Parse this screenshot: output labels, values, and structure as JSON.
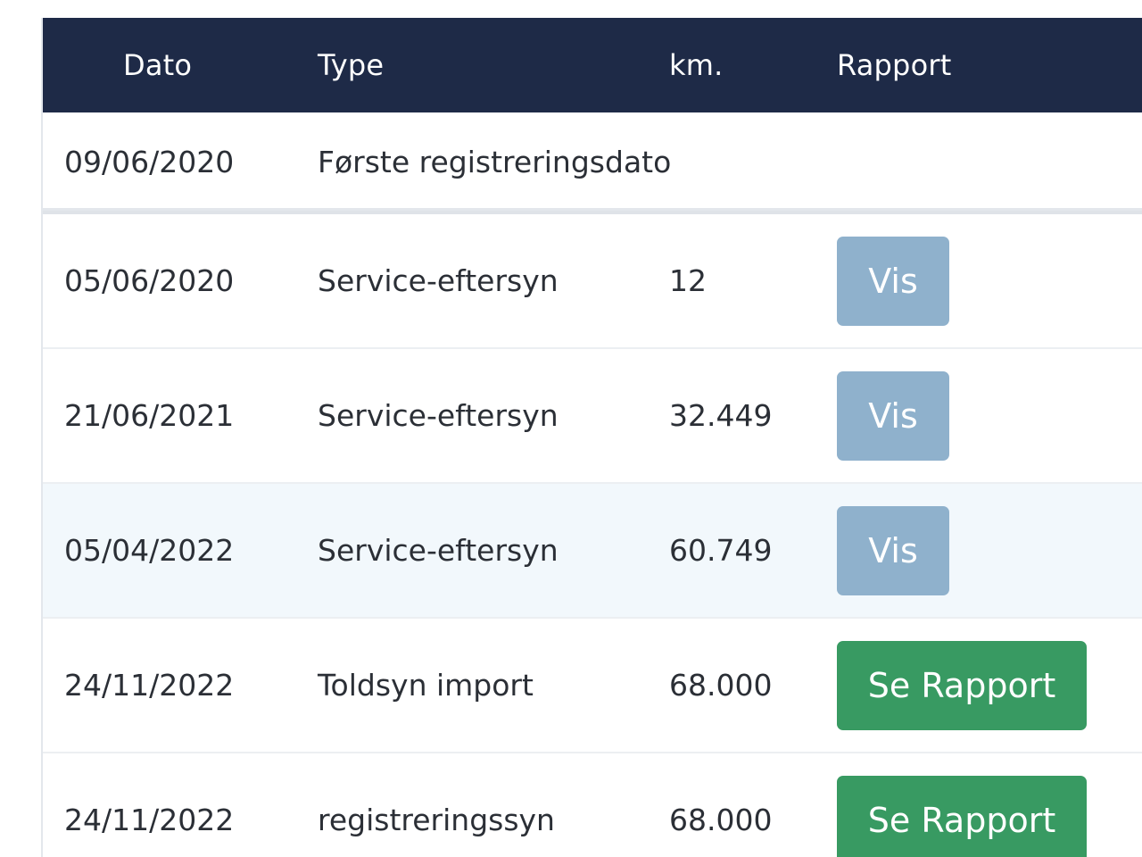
{
  "table": {
    "headers": {
      "date": "Dato",
      "type": "Type",
      "km": "km.",
      "report": "Rapport"
    },
    "rows": [
      {
        "date": "09/06/2020",
        "type": "Første registreringsdato",
        "km": "",
        "action": ""
      },
      {
        "date": "05/06/2020",
        "type": "Service-eftersyn",
        "km": "12",
        "action": "Vis"
      },
      {
        "date": "21/06/2021",
        "type": "Service-eftersyn",
        "km": "32.449",
        "action": "Vis"
      },
      {
        "date": "05/04/2022",
        "type": "Service-eftersyn",
        "km": "60.749",
        "action": "Vis"
      },
      {
        "date": "24/11/2022",
        "type": "Toldsyn import",
        "km": "68.000",
        "action": "Se Rapport"
      },
      {
        "date": "24/11/2022",
        "type": "registreringssyn",
        "km": "68.000",
        "action": "Se Rapport"
      }
    ]
  },
  "colors": {
    "header_bg": "#1e2a47",
    "vis_button": "#8fb1cc",
    "report_button": "#389a62",
    "highlight_row": "#f2f8fc"
  }
}
